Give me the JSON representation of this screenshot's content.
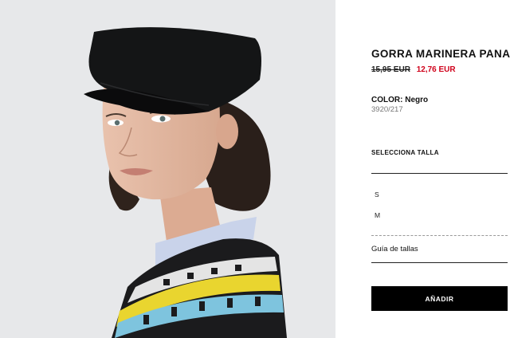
{
  "product": {
    "title": "GORRA MARINERA PANA",
    "price_old": "15,95 EUR",
    "price_new": "12,76 EUR",
    "color_label": "COLOR: Negro",
    "reference": "3920/217"
  },
  "size_selector": {
    "label": "SELECCIONA TALLA",
    "options": [
      "S",
      "M"
    ],
    "guide_link": "Guía de tallas"
  },
  "actions": {
    "add_label": "AÑADIR"
  },
  "colors": {
    "accent_sale": "#d0021b",
    "button_bg": "#000000",
    "photo_bg": "#e7e8ea"
  }
}
